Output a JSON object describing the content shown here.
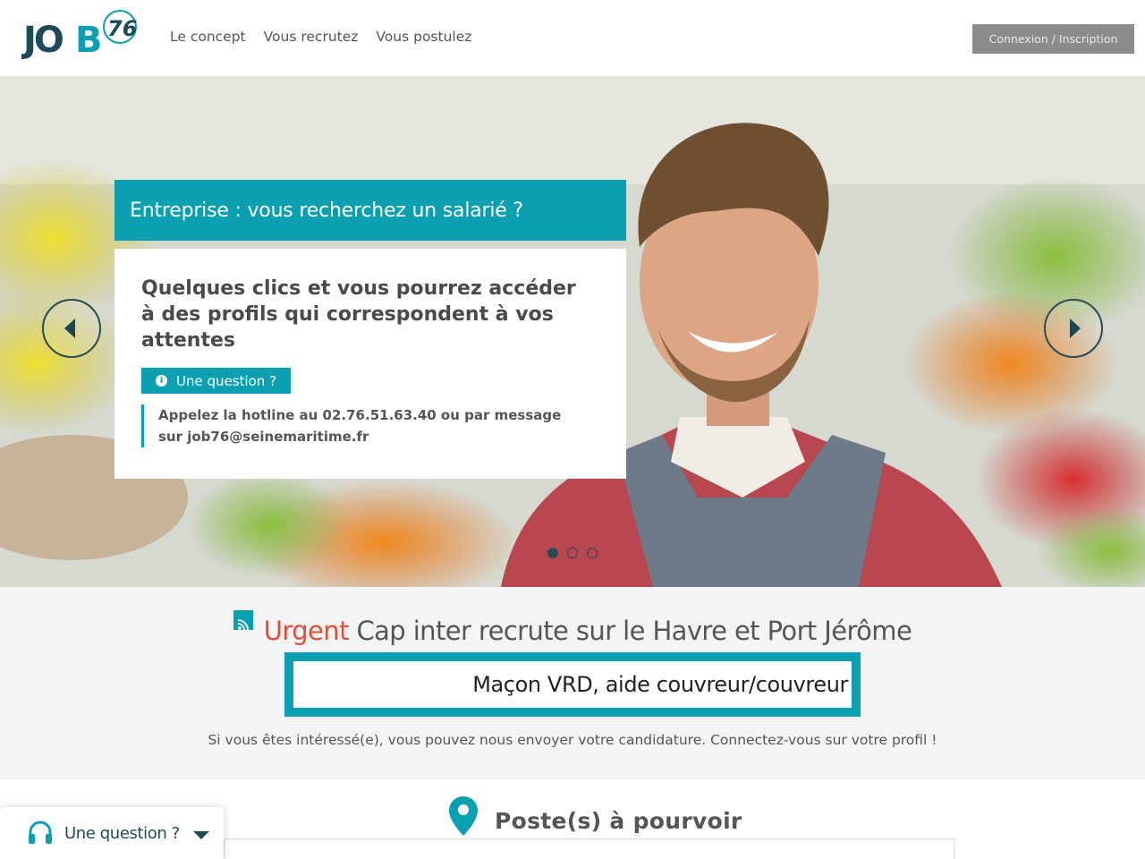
{
  "header": {
    "logo_text": "JOB76",
    "nav": [
      {
        "label": "Le concept"
      },
      {
        "label": "Vous recrutez"
      },
      {
        "label": "Vous postulez"
      }
    ],
    "login_label": "Connexion / Inscription"
  },
  "hero": {
    "title": "Entreprise : vous recherchez un salarié ?",
    "text": "Quelques clics et vous pourrez accéder à des profils qui correspondent à vos attentes",
    "question_label": "Une question ?",
    "hotline": "Appelez la hotline au 02.76.51.63.40 ou par message sur job76@seinemaritime.fr",
    "slide_count": 3,
    "active_slide": 1,
    "colors": {
      "accent": "#0aa0b2"
    }
  },
  "urgent": {
    "icon": "rss-icon",
    "label": "Urgent",
    "heading": "Cap inter recrute sur le Havre et Port Jérôme",
    "jobs_text": "Maçon VRD, aide couvreur/couvreur",
    "interest_text": "Si vous êtes intéressé(e), vous pouvez nous envoyer votre candidature. Connectez-vous sur votre profil !",
    "colors": {
      "urgent": "#e24e36"
    }
  },
  "postes": {
    "icon": "map-pin-icon",
    "title": "Poste(s) à pourvoir"
  },
  "help_widget": {
    "icon": "headset-icon",
    "label": "Une question ?"
  }
}
